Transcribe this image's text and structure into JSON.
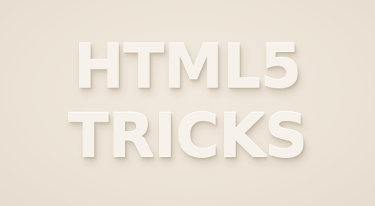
{
  "headline": {
    "line1": "HTML5",
    "line2": "TRICKS"
  },
  "colors": {
    "background": "#ede4d8",
    "text": "#f6f1ea"
  }
}
